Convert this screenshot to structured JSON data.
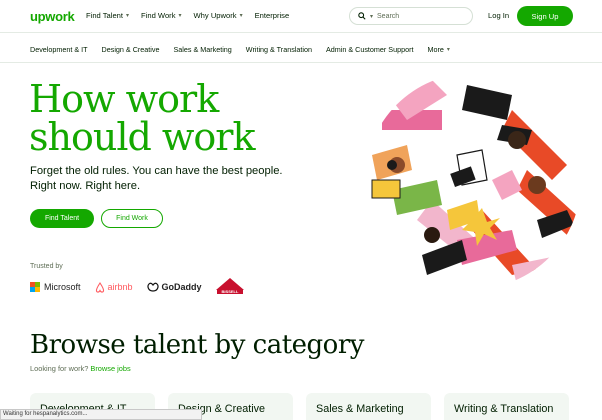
{
  "header": {
    "logo": "upwork",
    "nav": [
      "Find Talent",
      "Find Work",
      "Why Upwork",
      "Enterprise"
    ],
    "search_placeholder": "Search",
    "login": "Log In",
    "signup": "Sign Up"
  },
  "categories": [
    "Development & IT",
    "Design & Creative",
    "Sales & Marketing",
    "Writing & Translation",
    "Admin & Customer Support"
  ],
  "more_label": "More",
  "hero": {
    "title_line1": "How work",
    "title_line2": "should work",
    "subtitle_line1": "Forget the old rules. You can have the best people.",
    "subtitle_line2": "Right now. Right here.",
    "btn_talent": "Find Talent",
    "btn_work": "Find Work",
    "trusted_by": "Trusted by"
  },
  "logos": {
    "microsoft": "Microsoft",
    "airbnb": "airbnb",
    "godaddy": "GoDaddy",
    "bissell": "BISSELL"
  },
  "browse": {
    "title": "Browse talent by category",
    "sub_prefix": "Looking for work?",
    "sub_link": "Browse jobs"
  },
  "category_cards": [
    "Development & IT",
    "Design & Creative",
    "Sales & Marketing",
    "Writing & Translation"
  ],
  "status_bar": "Waiting for hespanalytics.com...",
  "colors": {
    "brand": "#14a800",
    "ink": "#001e00",
    "muted": "#5e6d55",
    "card_bg": "#f2f7f2"
  }
}
